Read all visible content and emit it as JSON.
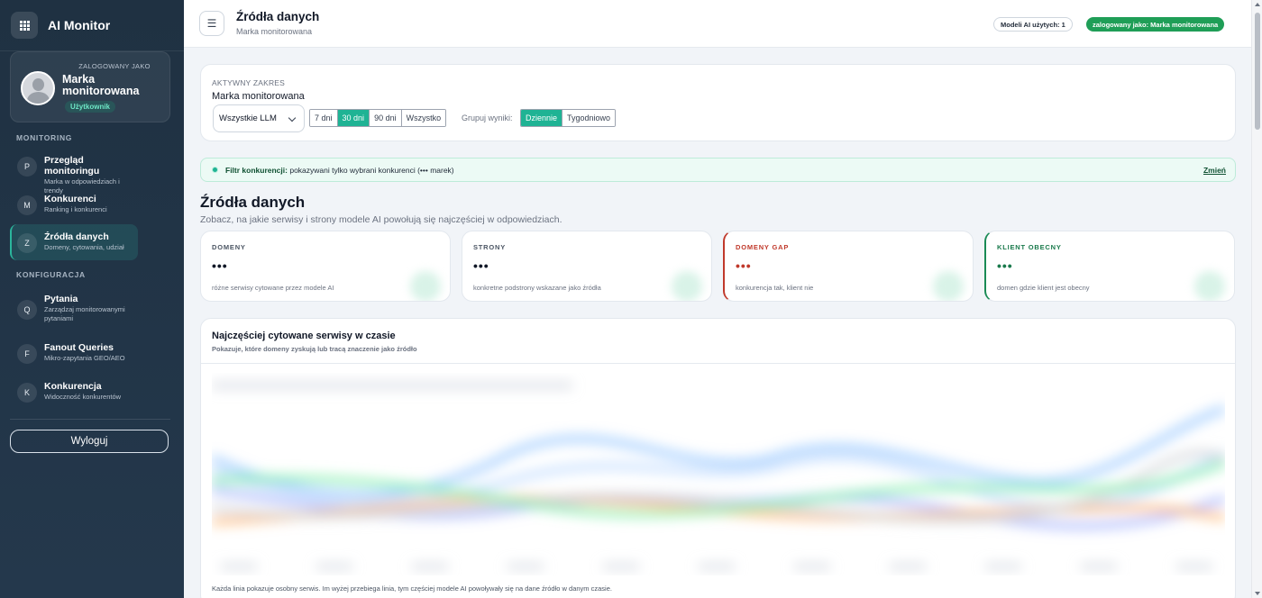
{
  "app": {
    "name": "AI Monitor"
  },
  "user": {
    "label": "ZALOGOWANY JAKO",
    "name": "Marka monitorowana",
    "role": "Użytkownik"
  },
  "sidebar": {
    "sections": [
      "MONITORING",
      "KONFIGURACJA"
    ],
    "items": [
      {
        "letter": "P",
        "title": "Przegląd monitoringu",
        "sub": "Marka w odpowiedziach i trendy",
        "active": false
      },
      {
        "letter": "M",
        "title": "Konkurenci",
        "sub": "Ranking i konkurenci",
        "active": false
      },
      {
        "letter": "Z",
        "title": "Źródła danych",
        "sub": "Domeny, cytowania, udział",
        "active": true
      },
      {
        "letter": "Q",
        "title": "Pytania",
        "sub": "Zarządzaj monitorowanymi pytaniami",
        "active": false
      },
      {
        "letter": "F",
        "title": "Fanout Queries",
        "sub": "Mikro-zapytania GEO/AEO",
        "active": false
      },
      {
        "letter": "K",
        "title": "Konkurencja",
        "sub": "Widoczność konkurentów",
        "active": false
      }
    ],
    "logout": "Wyloguj"
  },
  "topbar": {
    "title": "Źródła danych",
    "subtitle": "Marka monitorowana",
    "models_pill": "Modeli AI użytych: 1",
    "user_pill": "zalogowany jako: Marka monitorowana"
  },
  "range": {
    "label": "AKTYWNY ZAKRES",
    "value": "Marka monitorowana",
    "llm_select": "Wszystkie LLM",
    "periods": [
      "7 dni",
      "30 dni",
      "90 dni",
      "Wszystko"
    ],
    "period_selected": "30 dni",
    "group_label": "Grupuj wyniki:",
    "groups": [
      "Dziennie",
      "Tygodniowo"
    ],
    "group_selected": "Dziennie"
  },
  "filter": {
    "label": "Filtr konkurencji:",
    "text": "pokazywani tylko wybrani konkurenci (••• marek)",
    "link": "Zmień"
  },
  "section": {
    "title": "Źródła danych",
    "desc": "Zobacz, na jakie serwisy i strony modele AI powołują się najczęściej w odpowiedziach."
  },
  "stats": [
    {
      "label": "DOMENY",
      "value": "•••",
      "desc": "różne serwisy cytowane przez modele AI",
      "accent": ""
    },
    {
      "label": "STRONY",
      "value": "•••",
      "desc": "konkretne podstrony wskazane jako źródła",
      "accent": ""
    },
    {
      "label": "DOMENY GAP",
      "value": "•••",
      "desc": "konkurencja tak, klient nie",
      "accent": "red"
    },
    {
      "label": "KLIENT OBECNY",
      "value": "•••",
      "desc": "domen gdzie klient jest obecny",
      "accent": "green"
    }
  ],
  "chart": {
    "title": "Najczęściej cytowane serwisy w czasie",
    "subtitle": "Pokazuje, które domeny zyskują lub tracą znaczenie jako źródło",
    "note": "Każda linia pokazuje osobny serwis. Im wyżej przebiega linia, tym częściej modele AI powoływały się na dane źródło w danym czasie.",
    "blurred": true,
    "series_colors": [
      "#93c5fd",
      "#bfdbfe",
      "#a5b4fc",
      "#fdba74",
      "#d1d5db",
      "#86efac",
      "#9ca3af"
    ]
  },
  "colors": {
    "accent": "#1fb394",
    "sidebar": "#1f3142",
    "gap": "#c0392b",
    "present": "#1a7a4c"
  }
}
